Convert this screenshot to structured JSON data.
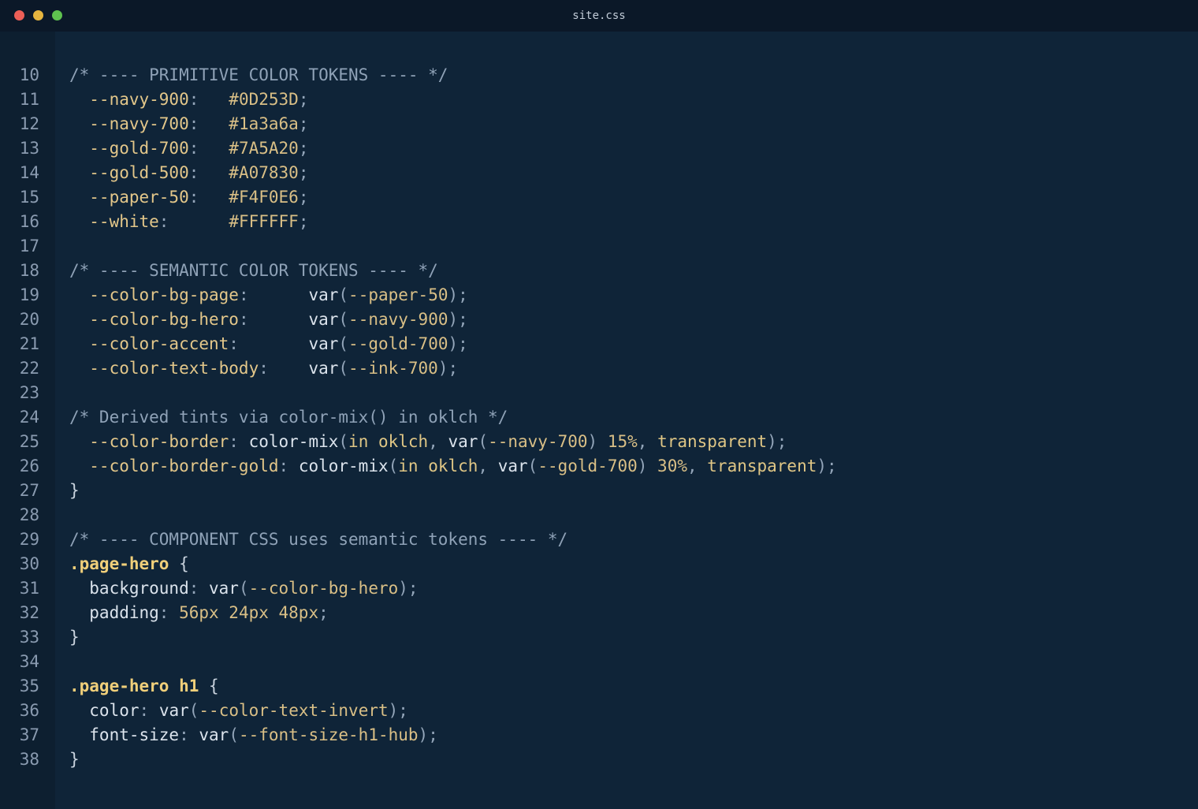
{
  "window": {
    "title": "site.css",
    "controls": [
      "close",
      "minimize",
      "maximize"
    ]
  },
  "editor": {
    "lines": [
      {
        "n": "10",
        "tokens": [
          {
            "t": "cm",
            "s": "/* ---- PRIMITIVE COLOR TOKENS ---- */"
          }
        ]
      },
      {
        "n": "11",
        "tokens": [
          {
            "t": "prop",
            "s": "  --navy-900"
          },
          {
            "t": "p",
            "s": ":   "
          },
          {
            "t": "val",
            "s": "#0D253D"
          },
          {
            "t": "p",
            "s": ";"
          }
        ]
      },
      {
        "n": "12",
        "tokens": [
          {
            "t": "prop",
            "s": "  --navy-700"
          },
          {
            "t": "p",
            "s": ":   "
          },
          {
            "t": "val",
            "s": "#1a3a6a"
          },
          {
            "t": "p",
            "s": ";"
          }
        ]
      },
      {
        "n": "13",
        "tokens": [
          {
            "t": "prop",
            "s": "  --gold-700"
          },
          {
            "t": "p",
            "s": ":   "
          },
          {
            "t": "val",
            "s": "#7A5A20"
          },
          {
            "t": "p",
            "s": ";"
          }
        ]
      },
      {
        "n": "14",
        "tokens": [
          {
            "t": "prop",
            "s": "  --gold-500"
          },
          {
            "t": "p",
            "s": ":   "
          },
          {
            "t": "val",
            "s": "#A07830"
          },
          {
            "t": "p",
            "s": ";"
          }
        ]
      },
      {
        "n": "15",
        "tokens": [
          {
            "t": "prop",
            "s": "  --paper-50"
          },
          {
            "t": "p",
            "s": ":   "
          },
          {
            "t": "val",
            "s": "#F4F0E6"
          },
          {
            "t": "p",
            "s": ";"
          }
        ]
      },
      {
        "n": "16",
        "tokens": [
          {
            "t": "prop",
            "s": "  --white"
          },
          {
            "t": "p",
            "s": ":      "
          },
          {
            "t": "val",
            "s": "#FFFFFF"
          },
          {
            "t": "p",
            "s": ";"
          }
        ]
      },
      {
        "n": "17",
        "tokens": []
      },
      {
        "n": "18",
        "tokens": [
          {
            "t": "cm",
            "s": "/* ---- SEMANTIC COLOR TOKENS ---- */"
          }
        ]
      },
      {
        "n": "19",
        "tokens": [
          {
            "t": "prop",
            "s": "  --color-bg-page"
          },
          {
            "t": "p",
            "s": ":      "
          },
          {
            "t": "fn",
            "s": "var"
          },
          {
            "t": "p",
            "s": "("
          },
          {
            "t": "val",
            "s": "--paper-50"
          },
          {
            "t": "p",
            "s": ");"
          }
        ]
      },
      {
        "n": "20",
        "tokens": [
          {
            "t": "prop",
            "s": "  --color-bg-hero"
          },
          {
            "t": "p",
            "s": ":      "
          },
          {
            "t": "fn",
            "s": "var"
          },
          {
            "t": "p",
            "s": "("
          },
          {
            "t": "val",
            "s": "--navy-900"
          },
          {
            "t": "p",
            "s": ");"
          }
        ]
      },
      {
        "n": "21",
        "tokens": [
          {
            "t": "prop",
            "s": "  --color-accent"
          },
          {
            "t": "p",
            "s": ":       "
          },
          {
            "t": "fn",
            "s": "var"
          },
          {
            "t": "p",
            "s": "("
          },
          {
            "t": "val",
            "s": "--gold-700"
          },
          {
            "t": "p",
            "s": ");"
          }
        ]
      },
      {
        "n": "22",
        "tokens": [
          {
            "t": "prop",
            "s": "  --color-text-body"
          },
          {
            "t": "p",
            "s": ":    "
          },
          {
            "t": "fn",
            "s": "var"
          },
          {
            "t": "p",
            "s": "("
          },
          {
            "t": "val",
            "s": "--ink-700"
          },
          {
            "t": "p",
            "s": ");"
          }
        ]
      },
      {
        "n": "23",
        "tokens": []
      },
      {
        "n": "24",
        "tokens": [
          {
            "t": "cm",
            "s": "/* Derived tints via color-mix() in oklch */"
          }
        ]
      },
      {
        "n": "25",
        "tokens": [
          {
            "t": "prop",
            "s": "  --color-border"
          },
          {
            "t": "p",
            "s": ": "
          },
          {
            "t": "fn",
            "s": "color-mix"
          },
          {
            "t": "p",
            "s": "("
          },
          {
            "t": "kw",
            "s": "in oklch"
          },
          {
            "t": "p",
            "s": ", "
          },
          {
            "t": "fn",
            "s": "var"
          },
          {
            "t": "p",
            "s": "("
          },
          {
            "t": "val",
            "s": "--navy-700"
          },
          {
            "t": "p",
            "s": ") "
          },
          {
            "t": "val",
            "s": "15%"
          },
          {
            "t": "p",
            "s": ", "
          },
          {
            "t": "kw",
            "s": "transparent"
          },
          {
            "t": "p",
            "s": ");"
          }
        ]
      },
      {
        "n": "26",
        "tokens": [
          {
            "t": "prop",
            "s": "  --color-border-gold"
          },
          {
            "t": "p",
            "s": ": "
          },
          {
            "t": "fn",
            "s": "color-mix"
          },
          {
            "t": "p",
            "s": "("
          },
          {
            "t": "kw",
            "s": "in oklch"
          },
          {
            "t": "p",
            "s": ", "
          },
          {
            "t": "fn",
            "s": "var"
          },
          {
            "t": "p",
            "s": "("
          },
          {
            "t": "val",
            "s": "--gold-700"
          },
          {
            "t": "p",
            "s": ") "
          },
          {
            "t": "val",
            "s": "30%"
          },
          {
            "t": "p",
            "s": ", "
          },
          {
            "t": "kw",
            "s": "transparent"
          },
          {
            "t": "p",
            "s": ");"
          }
        ]
      },
      {
        "n": "27",
        "tokens": [
          {
            "t": "br",
            "s": "}"
          }
        ]
      },
      {
        "n": "28",
        "tokens": []
      },
      {
        "n": "29",
        "tokens": [
          {
            "t": "cm",
            "s": "/* ---- COMPONENT CSS uses semantic tokens ---- */"
          }
        ]
      },
      {
        "n": "30",
        "tokens": [
          {
            "t": "sel",
            "s": ".page-hero"
          },
          {
            "t": "br",
            "s": " {"
          }
        ]
      },
      {
        "n": "31",
        "tokens": [
          {
            "t": "fn",
            "s": "  background"
          },
          {
            "t": "p",
            "s": ": "
          },
          {
            "t": "fn",
            "s": "var"
          },
          {
            "t": "p",
            "s": "("
          },
          {
            "t": "val",
            "s": "--color-bg-hero"
          },
          {
            "t": "p",
            "s": ");"
          }
        ]
      },
      {
        "n": "32",
        "tokens": [
          {
            "t": "fn",
            "s": "  padding"
          },
          {
            "t": "p",
            "s": ": "
          },
          {
            "t": "val",
            "s": "56px 24px 48px"
          },
          {
            "t": "p",
            "s": ";"
          }
        ]
      },
      {
        "n": "33",
        "tokens": [
          {
            "t": "br",
            "s": "}"
          }
        ]
      },
      {
        "n": "34",
        "tokens": []
      },
      {
        "n": "35",
        "tokens": [
          {
            "t": "sel",
            "s": ".page-hero h1"
          },
          {
            "t": "br",
            "s": " {"
          }
        ]
      },
      {
        "n": "36",
        "tokens": [
          {
            "t": "fn",
            "s": "  color"
          },
          {
            "t": "p",
            "s": ": "
          },
          {
            "t": "fn",
            "s": "var"
          },
          {
            "t": "p",
            "s": "("
          },
          {
            "t": "val",
            "s": "--color-text-invert"
          },
          {
            "t": "p",
            "s": ");"
          }
        ]
      },
      {
        "n": "37",
        "tokens": [
          {
            "t": "fn",
            "s": "  font-size"
          },
          {
            "t": "p",
            "s": ": "
          },
          {
            "t": "fn",
            "s": "var"
          },
          {
            "t": "p",
            "s": "("
          },
          {
            "t": "val",
            "s": "--font-size-h1-hub"
          },
          {
            "t": "p",
            "s": ");"
          }
        ]
      },
      {
        "n": "38",
        "tokens": [
          {
            "t": "br",
            "s": "}"
          }
        ]
      }
    ]
  }
}
